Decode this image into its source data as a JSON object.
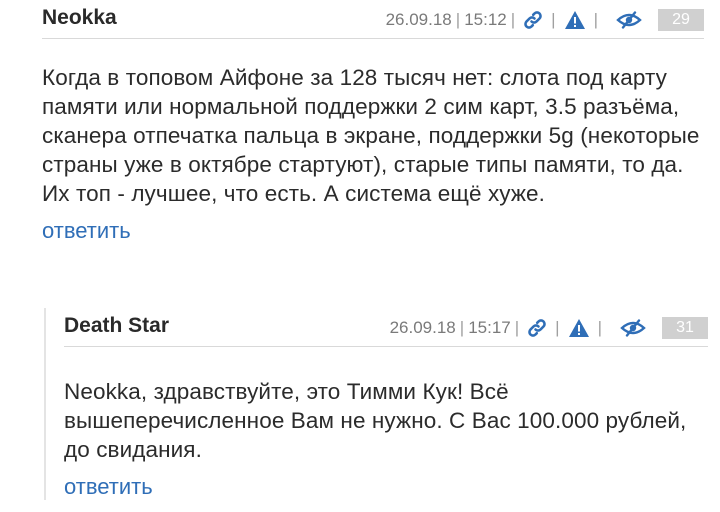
{
  "comments": [
    {
      "author": "Neokka",
      "date": "26.09.18",
      "time": "15:12",
      "score": "29",
      "text": "Когда в топовом Айфоне за 128 тысяч нет: слота под карту памяти или нормальной поддержки 2 сим карт, 3.5 разъёма, сканера отпечатка пальца в экране, поддержки 5g (некоторые страны уже в октябре стартуют), старые типы памяти, то да. Их топ - лучшее, что есть. А система ещё хуже.",
      "reply_label": "ответить"
    },
    {
      "author": "Death Star",
      "date": "26.09.18",
      "time": "15:17",
      "score": "31",
      "text": "Neokka, здравствуйте, это Тимми Кук! Всё вышеперечисленное Вам не нужно. С Вас 100.000 рублей, до свидания.",
      "reply_label": "ответить"
    }
  ],
  "separator": "|",
  "icons": {
    "link": "link-icon",
    "warning": "warning-icon",
    "hide": "eye-slash-icon"
  },
  "colors": {
    "accent": "#2f6eb7",
    "score_bg": "#d0d0d0",
    "meta_text": "#7a7a7a"
  }
}
